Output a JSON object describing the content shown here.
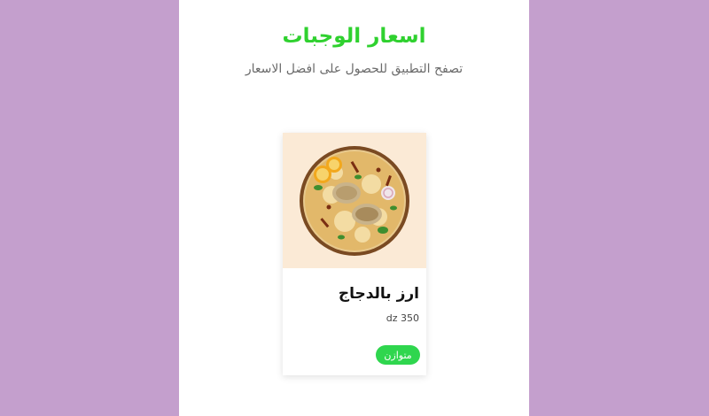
{
  "header": {
    "title": "اسعار الوجبات",
    "subtitle": "تصفح التطبيق للحصول على افضل الاسعار"
  },
  "meal_card": {
    "image_icon": "rice-with-chicken-dish-image",
    "name": "ارز بالدجاج",
    "price": "dz 350",
    "badge": "متوازن"
  },
  "colors": {
    "page_background": "#c49fcd",
    "panel_background": "#ffffff",
    "title": "#2fd12f",
    "badge": "#2fd64e",
    "image_background": "#fbead6"
  }
}
